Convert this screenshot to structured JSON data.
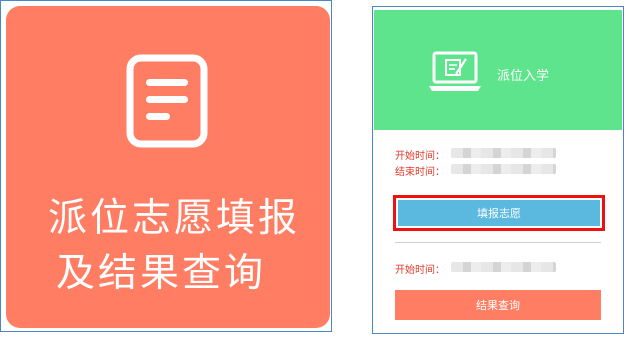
{
  "left_tile": {
    "line1": "派位志愿填报",
    "line2": "及结果查询",
    "icon": "document-icon",
    "color": "#ff7e63"
  },
  "right_card": {
    "header": {
      "title": "派位入学",
      "icon": "laptop-edit-icon",
      "color": "#5ee48c"
    },
    "fill_section": {
      "start_label": "开始时间：",
      "end_label": "结束时间：",
      "button_label": "填报志愿",
      "button_color": "#5bb8de",
      "highlight_color": "#ee1111"
    },
    "result_section": {
      "start_label": "开始时间：",
      "button_label": "结果查询",
      "button_color": "#ff7e63"
    }
  }
}
